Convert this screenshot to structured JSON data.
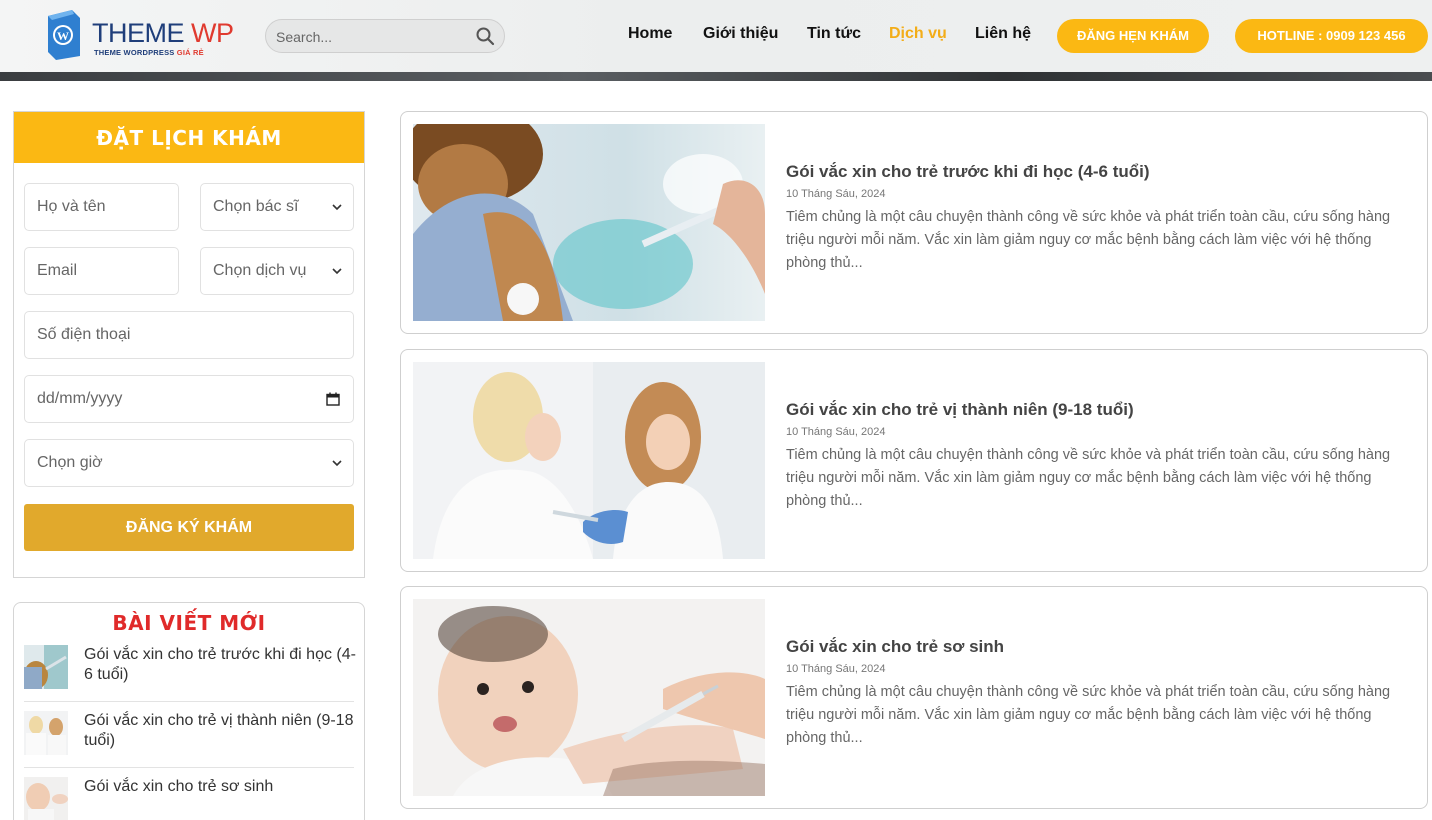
{
  "header": {
    "logo_main": "THEME",
    "logo_accent": "WP",
    "logo_sub_main": "THEME WORDPRESS ",
    "logo_sub_accent": "GIÁ RẺ",
    "search_placeholder": "Search...",
    "nav": [
      {
        "label": "Home",
        "active": false
      },
      {
        "label": "Giới thiệu",
        "active": false
      },
      {
        "label": "Tin tức",
        "active": false
      },
      {
        "label": "Dịch vụ",
        "active": true
      },
      {
        "label": "Liên hệ",
        "active": false
      }
    ],
    "appointment_button": "ĐĂNG HẸN KHÁM",
    "hotline_button": "HOTLINE : 0909 123 456"
  },
  "booking_form": {
    "title": "ĐẶT LỊCH KHÁM",
    "name_placeholder": "Họ và tên",
    "doctor_select": "Chọn bác sĩ",
    "email_placeholder": "Email",
    "service_select": "Chọn dịch vụ",
    "phone_placeholder": "Số điện thoại",
    "date_placeholder": "dd/mm/yyyy",
    "time_select": "Chọn giờ",
    "submit_label": "ĐĂNG KÝ KHÁM"
  },
  "recent_posts": {
    "title": "BÀI VIẾT MỚI",
    "items": [
      {
        "label": "Gói vắc xin cho trẻ trước khi đi học (4-6 tuổi)"
      },
      {
        "label": "Gói vắc xin cho trẻ vị thành niên (9-18 tuổi)"
      },
      {
        "label": "Gói vắc xin cho trẻ sơ sinh"
      }
    ]
  },
  "posts": [
    {
      "title": "Gói vắc xin cho trẻ trước khi đi học (4-6 tuổi)",
      "date": "10 Tháng Sáu, 2024",
      "excerpt": "Tiêm chủng là một câu chuyện thành công về sức khỏe và phát triển toàn cầu, cứu sống hàng triệu người mỗi năm. Vắc xin làm giảm nguy cơ mắc bệnh bằng cách làm việc với hệ thống phòng thủ..."
    },
    {
      "title": "Gói vắc xin cho trẻ vị thành niên (9-18 tuổi)",
      "date": "10 Tháng Sáu, 2024",
      "excerpt": "Tiêm chủng là một câu chuyện thành công về sức khỏe và phát triển toàn cầu, cứu sống hàng triệu người mỗi năm. Vắc xin làm giảm nguy cơ mắc bệnh bằng cách làm việc với hệ thống phòng thủ..."
    },
    {
      "title": "Gói vắc xin cho trẻ sơ sinh",
      "date": "10 Tháng Sáu, 2024",
      "excerpt": "Tiêm chủng là một câu chuyện thành công về sức khỏe và phát triển toàn cầu, cứu sống hàng triệu người mỗi năm. Vắc xin làm giảm nguy cơ mắc bệnh bằng cách làm việc với hệ thống phòng thủ..."
    }
  ],
  "colors": {
    "accent": "#fbb813",
    "active_nav": "#f3ad18",
    "submit": "#e1a92c",
    "recent_title": "#e02a2a"
  }
}
